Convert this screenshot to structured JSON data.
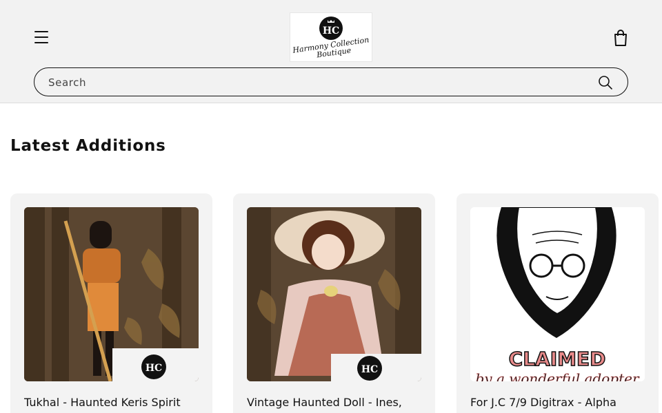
{
  "header": {
    "menu_icon": "hamburger-menu-icon",
    "logo": {
      "monogram": "HC",
      "line1": "Harmony Collection",
      "line2": "Boutique"
    },
    "cart_icon": "shopping-bag-icon"
  },
  "search": {
    "placeholder": "Search",
    "icon": "search-icon"
  },
  "section": {
    "title": "Latest Additions"
  },
  "products": [
    {
      "title": "Tukhal - Haunted Keris Spirit",
      "image": "figure-statue-photo"
    },
    {
      "title": "Vintage Haunted Doll - Ines,",
      "image": "porcelain-doll-photo"
    },
    {
      "title": "For J.C 7/9 Digitrax - Alpha",
      "image": "claimed-illustration",
      "overlay_text": "CLAIMED",
      "overlay_sub": "by a wonderful adopter"
    }
  ],
  "colors": {
    "header_bg": "#f2f2f2",
    "text": "#121212",
    "card_bg": "#f3f3f3",
    "claimed_red": "#e88a8a"
  }
}
